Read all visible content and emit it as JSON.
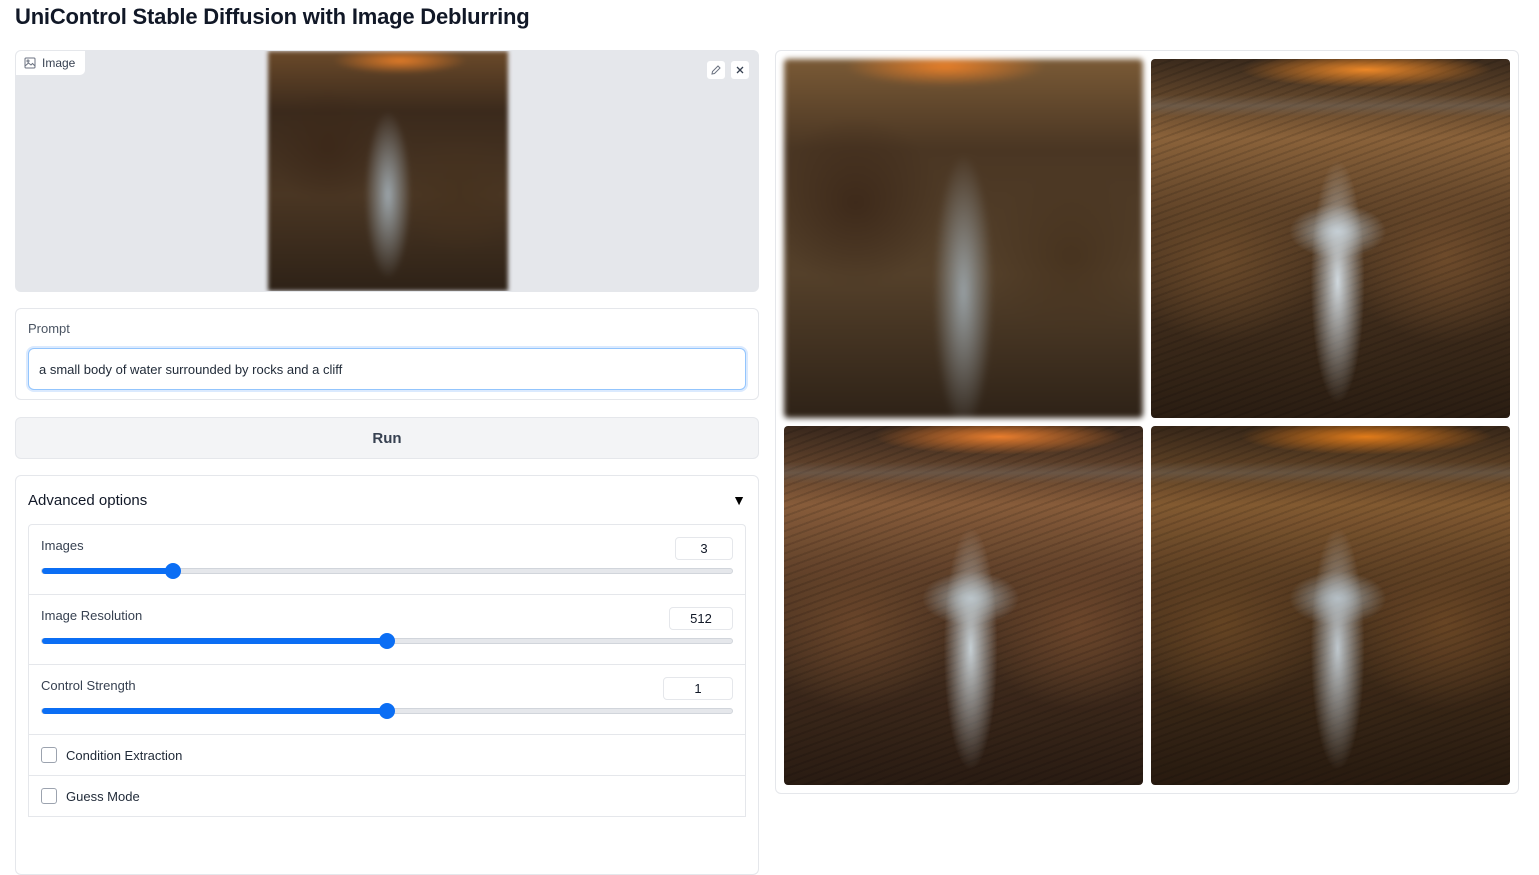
{
  "page": {
    "title": "UniControl Stable Diffusion with Image Deblurring"
  },
  "image_input": {
    "label": "Image"
  },
  "prompt": {
    "label": "Prompt",
    "value": "a small body of water surrounded by rocks and a cliff"
  },
  "run": {
    "label": "Run"
  },
  "advanced": {
    "title": "Advanced options",
    "arrow": "▼",
    "sliders": [
      {
        "label": "Images",
        "value": "3",
        "fraction": 0.19
      },
      {
        "label": "Image Resolution",
        "value": "512",
        "fraction": 0.5
      },
      {
        "label": "Control Strength",
        "value": "1",
        "fraction": 0.5
      }
    ],
    "checkboxes": [
      {
        "label": "Condition Extraction",
        "checked": false
      },
      {
        "label": "Guess Mode",
        "checked": false
      }
    ]
  },
  "gallery": {
    "images": [
      {
        "name": "blurred-control-image"
      },
      {
        "name": "output-image-1"
      },
      {
        "name": "output-image-2"
      },
      {
        "name": "output-image-3"
      }
    ]
  },
  "colors": {
    "accent": "#0b6ef4",
    "focus": "#93c5fd"
  }
}
